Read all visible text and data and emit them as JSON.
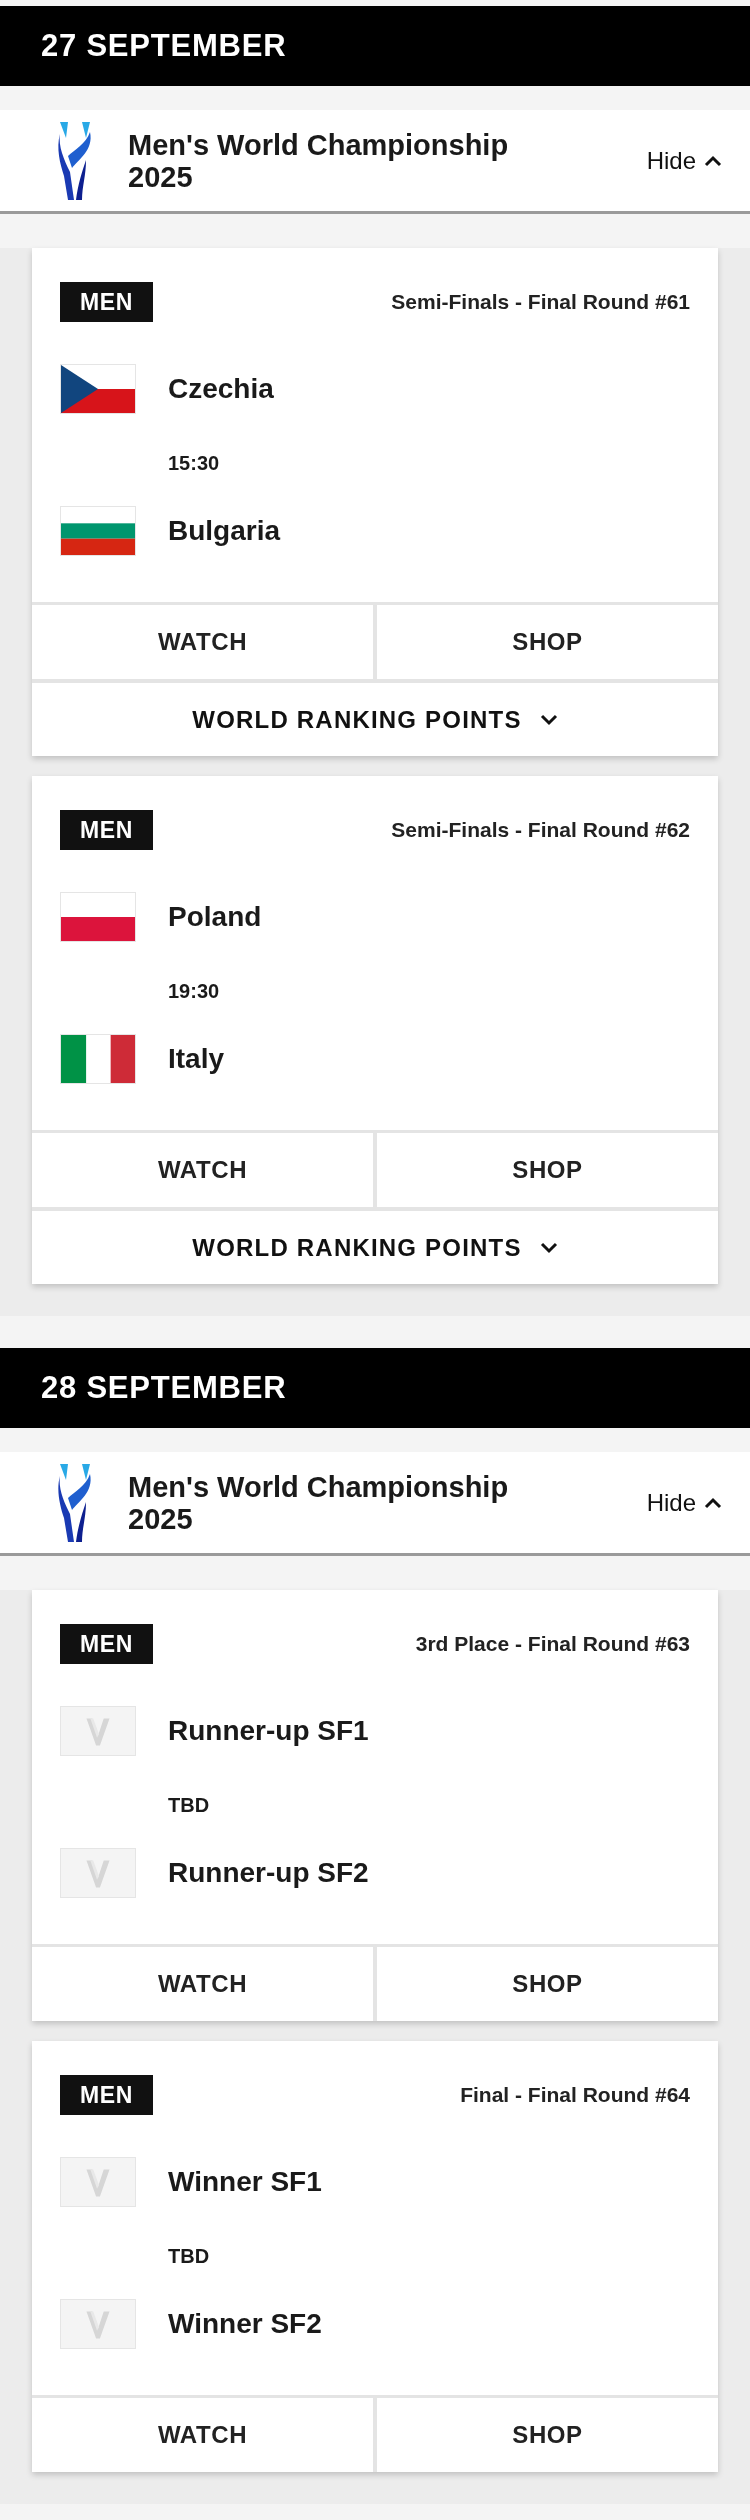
{
  "days": [
    {
      "date": "27 SEPTEMBER",
      "tournament": {
        "name": "Men's World Championship 2025",
        "toggle": "Hide",
        "expanded": true
      },
      "matches": [
        {
          "category": "MEN",
          "round": "Semi-Finals - Final Round #61",
          "teams": [
            {
              "name": "Czechia",
              "kind": "cz"
            },
            {
              "name": "Bulgaria",
              "kind": "bg"
            }
          ],
          "time": "15:30",
          "buttons": [
            "WATCH",
            "SHOP"
          ],
          "ranking_points": {
            "label": "WORLD RANKING POINTS",
            "expanded": false
          }
        },
        {
          "category": "MEN",
          "round": "Semi-Finals - Final Round #62",
          "teams": [
            {
              "name": "Poland",
              "kind": "pl"
            },
            {
              "name": "Italy",
              "kind": "it"
            }
          ],
          "time": "19:30",
          "buttons": [
            "WATCH",
            "SHOP"
          ],
          "ranking_points": {
            "label": "WORLD RANKING POINTS",
            "expanded": false
          }
        }
      ]
    },
    {
      "date": "28 SEPTEMBER",
      "tournament": {
        "name": "Men's World Championship 2025",
        "toggle": "Hide",
        "expanded": true
      },
      "matches": [
        {
          "category": "MEN",
          "round": "3rd Place - Final Round #63",
          "teams": [
            {
              "name": "Runner-up SF1",
              "kind": "placeholder"
            },
            {
              "name": "Runner-up SF2",
              "kind": "placeholder"
            }
          ],
          "time": "TBD",
          "buttons": [
            "WATCH",
            "SHOP"
          ]
        },
        {
          "category": "MEN",
          "round": "Final - Final Round #64",
          "teams": [
            {
              "name": "Winner SF1",
              "kind": "placeholder"
            },
            {
              "name": "Winner SF2",
              "kind": "placeholder"
            }
          ],
          "time": "TBD",
          "buttons": [
            "WATCH",
            "SHOP"
          ]
        }
      ]
    }
  ]
}
